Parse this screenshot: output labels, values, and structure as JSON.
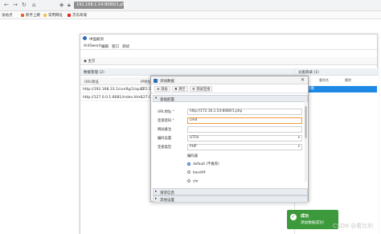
{
  "browser": {
    "url": "192.168.1.54:8080/1.php",
    "bookmarks": [
      "访站点",
      "新手上路",
      "常用网址",
      "京东商城"
    ]
  },
  "app": {
    "title": "中国蚁剑",
    "menu": [
      "AntSword",
      "编辑",
      "窗口",
      "调试"
    ],
    "home_tab": "主页",
    "data_panel_title": "数据管理 (2)",
    "columns": [
      "URL地址",
      "IP地址"
    ],
    "rows": [
      {
        "url": "http://192.168.33.1/config/1/api/3",
        "ip": "172.16"
      },
      {
        "url": "http://127.0.0.1:8081/index.html",
        "ip": "127.0"
      }
    ],
    "category_title": "分类目录 (1)",
    "category_toolbar": [
      "添加",
      "重命名",
      "删除"
    ],
    "category_item": "默认分类"
  },
  "dialog": {
    "title": "添加数据",
    "toolbar": [
      "添加",
      "清空",
      "测试连接"
    ],
    "section_basic": "基础配置",
    "fields": {
      "url_label": "URL地址",
      "url_value": "http://172.16.1.54:8080/1.php",
      "password_label": "连接密码",
      "password_value": "cmd",
      "note_label": "网站备注",
      "note_value": "",
      "encoding_label": "编码设置",
      "encoding_value": "UTF8",
      "type_label": "连接类型",
      "type_value": "PHP",
      "encoder_label": "编码器",
      "encoders": [
        "default (不推荐)",
        "base64",
        "chr"
      ]
    },
    "section_request": "请求信息",
    "section_other": "其他设置"
  },
  "toast": {
    "title": "成功",
    "message": "添加数据成功!"
  },
  "watermark": "CSDN @看比利"
}
